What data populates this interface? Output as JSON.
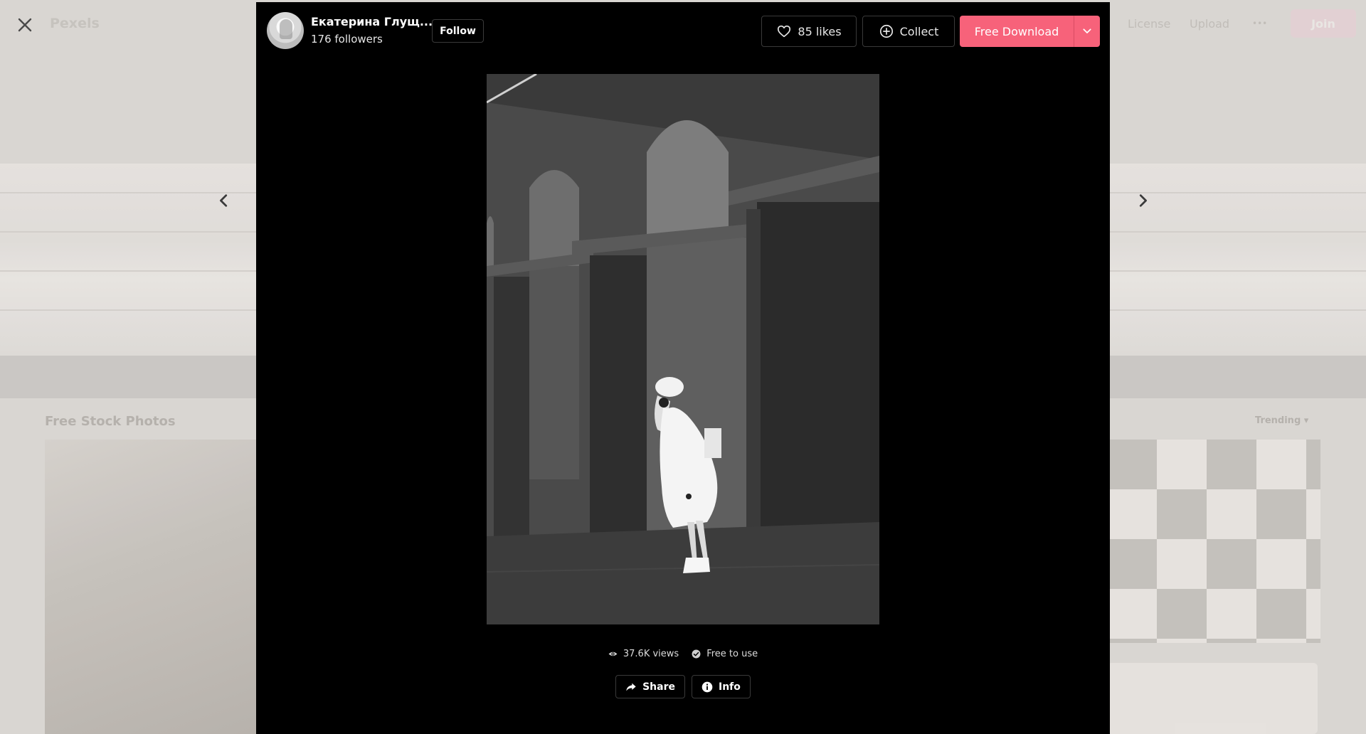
{
  "background": {
    "logo": "Pexels",
    "nav": {
      "license": "License",
      "upload": "Upload",
      "more": "•••",
      "join": "Join"
    },
    "section_title": "Free Stock Photos",
    "sort_label": "Trending"
  },
  "modal": {
    "author": {
      "name": "Екатерина Глущ...",
      "followers": "176 followers",
      "follow_label": "Follow"
    },
    "likes_label": "85 likes",
    "collect_label": "Collect",
    "download_label": "Free Download",
    "stats": {
      "views": "37.6K views",
      "license": "Free to use"
    },
    "share_label": "Share",
    "info_label": "Info"
  },
  "icons": {
    "close": "close-icon",
    "prev": "chevron-left-icon",
    "next": "chevron-right-icon",
    "likes": "heart-icon",
    "collect": "plus-circle-icon",
    "download_dropdown": "chevron-down-icon",
    "views": "eye-icon",
    "license": "check-circle-icon",
    "share": "share-arrow-icon",
    "info": "info-icon"
  },
  "colors": {
    "download": "#f7627a",
    "modal_bg": "#000000"
  }
}
